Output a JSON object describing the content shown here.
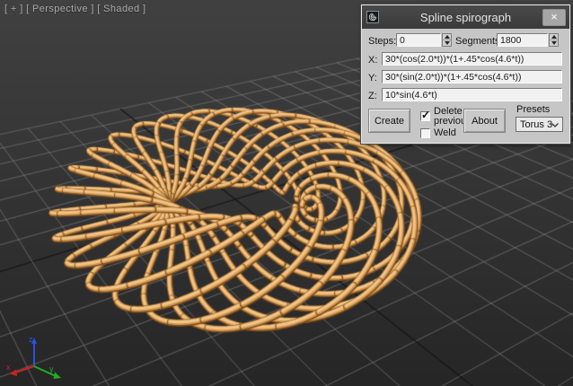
{
  "viewport": {
    "label": "[ + ] [ Perspective ] [ Shaded ]",
    "bg_top": "#414141",
    "bg_bottom": "#262626",
    "grid": {
      "spacing": 10,
      "line_color": "#9a9a9a",
      "axis_color": "#141414",
      "x_range": [
        -90,
        130
      ],
      "y_range": [
        -110,
        70
      ]
    },
    "axis_tripod": {
      "x_label": "x",
      "y_label": "y",
      "z_label": "z",
      "x_color": "#cf2222",
      "y_color": "#1fae1f",
      "z_color": "#2753e0"
    },
    "curve": {
      "segments": 1800,
      "r_base": 30,
      "freq_main": 2.0,
      "r_mod": 0.45,
      "freq_mod": 4.6,
      "z_amp": 10,
      "t_max_pi": 10,
      "color_dark": "#7d4e1f",
      "color_mid": "#d59a4e",
      "color_highlight": "#f0c48a"
    }
  },
  "dialog": {
    "title": "Spline spirograph",
    "glyphs": {
      "close": "✕",
      "check": "✓"
    },
    "fields": {
      "steps": {
        "label": "Steps:",
        "value": "0"
      },
      "segments": {
        "label": "Segments:",
        "value": "1800"
      },
      "x": {
        "label": "X:",
        "value": "30*(cos(2.0*t))*(1+.45*cos(4.6*t))"
      },
      "y": {
        "label": "Y:",
        "value": "30*(sin(2.0*t))*(1+.45*cos(4.6*t))"
      },
      "z": {
        "label": "Z:",
        "value": "10*sin(4.6*t)"
      }
    },
    "buttons": {
      "create": "Create",
      "about": "About"
    },
    "checkboxes": {
      "delete_previous": {
        "label": "Delete previous",
        "checked": true
      },
      "weld": {
        "label": "Weld",
        "checked": false
      }
    },
    "presets": {
      "label": "Presets",
      "value": "Torus 3"
    }
  }
}
